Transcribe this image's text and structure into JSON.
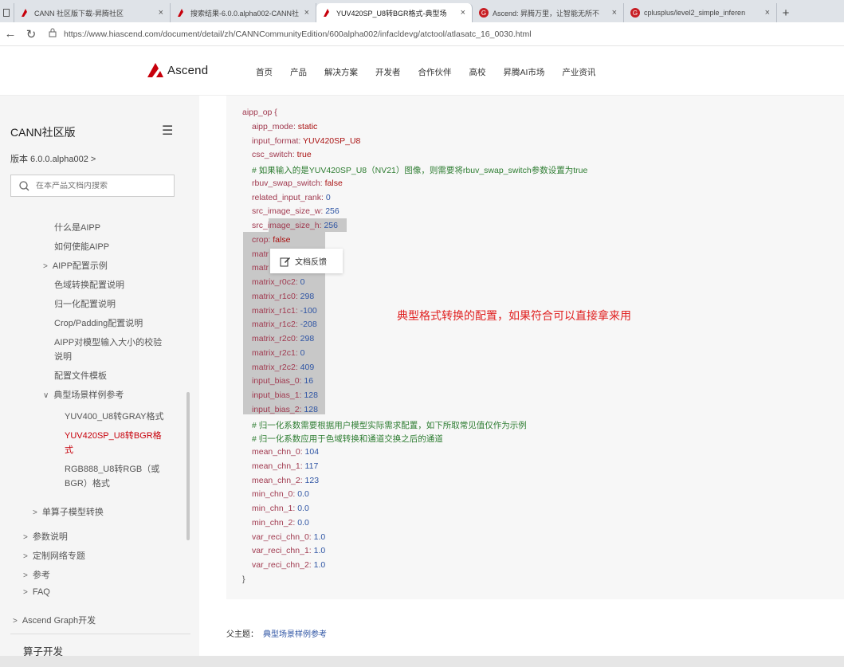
{
  "browser": {
    "tabs": [
      {
        "title": "CANN 社区版下载-昇腾社区",
        "icon": "ascend-logo",
        "active": false
      },
      {
        "title": "搜索结果-6.0.0.alpha002-CANN社",
        "icon": "ascend-logo",
        "active": false
      },
      {
        "title": "YUV420SP_U8转BGR格式-典型场",
        "icon": "ascend-logo",
        "active": true
      },
      {
        "title": "Ascend: 昇腾万里，让智能无所不",
        "icon": "gitee-logo",
        "active": false
      },
      {
        "title": "cplusplus/level2_simple_inferen",
        "icon": "gitee-logo",
        "active": false
      }
    ],
    "url": "https://www.hiascend.com/document/detail/zh/CANNCommunityEdition/600alpha002/infacldevg/atctool/atlasatc_16_0030.html"
  },
  "header": {
    "logo": "Ascend",
    "nav": [
      "首页",
      "产品",
      "解决方案",
      "开发者",
      "合作伙伴",
      "高校",
      "昇腾AI市场",
      "产业资讯"
    ]
  },
  "sidebar": {
    "title": "CANN社区版",
    "version": "版本  6.0.0.alpha002  >",
    "search_placeholder": "在本产品文档内搜索",
    "items": [
      {
        "label": "什么是AIPP",
        "arrow": ""
      },
      {
        "label": "如何使能AIPP",
        "arrow": ""
      },
      {
        "label": "AIPP配置示例",
        "arrow": ">"
      },
      {
        "label": "色域转换配置说明",
        "arrow": ""
      },
      {
        "label": "归一化配置说明",
        "arrow": ""
      },
      {
        "label": "Crop/Padding配置说明",
        "arrow": ""
      },
      {
        "label": "AIPP对模型输入大小的校验",
        "arrow": ""
      },
      {
        "label": "说明",
        "arrow": ""
      },
      {
        "label": "配置文件模板",
        "arrow": ""
      },
      {
        "label": "典型场景样例参考",
        "arrow": "∨"
      },
      {
        "label": "YUV400_U8转GRAY格式",
        "arrow": ""
      },
      {
        "label": "YUV420SP_U8转BGR格",
        "arrow": ""
      },
      {
        "label": "式",
        "arrow": ""
      },
      {
        "label": "RGB888_U8转RGB（或",
        "arrow": ""
      },
      {
        "label": "BGR）格式",
        "arrow": ""
      },
      {
        "label": "单算子模型转换",
        "arrow": ">"
      },
      {
        "label": "参数说明",
        "arrow": ">"
      },
      {
        "label": "定制网络专题",
        "arrow": ">"
      },
      {
        "label": "参考",
        "arrow": ">"
      },
      {
        "label": "FAQ",
        "arrow": ">"
      },
      {
        "label": "Ascend Graph开发",
        "arrow": ">"
      },
      {
        "label": "算子开发",
        "arrow": ""
      }
    ]
  },
  "code": {
    "lines": [
      {
        "k": "aipp_op {",
        "v": "",
        "type": "open"
      },
      {
        "k": "aipp_mode:",
        "v": " static",
        "type": "str"
      },
      {
        "k": "input_format:",
        "v": " YUV420SP_U8",
        "type": "str"
      },
      {
        "k": "csc_switch:",
        "v": " true",
        "type": "str"
      },
      {
        "k": "# 如果输入的是YUV420SP_U8（NV21）图像，则需要将rbuv_swap_switch参数设置为true",
        "v": "",
        "type": "cmt"
      },
      {
        "k": "rbuv_swap_switch:",
        "v": " false",
        "type": "str"
      },
      {
        "k": "related_input_rank:",
        "v": " 0",
        "type": "num"
      },
      {
        "k": "src_image_size_w:",
        "v": " 256",
        "type": "num"
      },
      {
        "k": "src_image_size_h:",
        "v": " 256",
        "type": "num"
      },
      {
        "k": "crop:",
        "v": " false",
        "type": "str"
      },
      {
        "k": "matr",
        "v": "",
        "type": "num"
      },
      {
        "k": "matr",
        "v": "",
        "type": "num"
      },
      {
        "k": "matrix_r0c2:",
        "v": " 0",
        "type": "num"
      },
      {
        "k": "matrix_r1c0:",
        "v": " 298",
        "type": "num"
      },
      {
        "k": "matrix_r1c1:",
        "v": " -100",
        "type": "num"
      },
      {
        "k": "matrix_r1c2:",
        "v": " -208",
        "type": "num"
      },
      {
        "k": "matrix_r2c0:",
        "v": " 298",
        "type": "num"
      },
      {
        "k": "matrix_r2c1:",
        "v": " 0",
        "type": "num"
      },
      {
        "k": "matrix_r2c2:",
        "v": " 409",
        "type": "num"
      },
      {
        "k": "input_bias_0:",
        "v": " 16",
        "type": "num"
      },
      {
        "k": "input_bias_1:",
        "v": " 128",
        "type": "num"
      },
      {
        "k": "input_bias_2:",
        "v": " 128",
        "type": "num"
      },
      {
        "k": "# 归一化系数需要根据用户模型实际需求配置，如下所取常见值仅作为示例",
        "v": "",
        "type": "cmt"
      },
      {
        "k": "# 归一化系数应用于色域转换和通道交换之后的通道",
        "v": "",
        "type": "cmt"
      },
      {
        "k": "mean_chn_0:",
        "v": " 104",
        "type": "num"
      },
      {
        "k": "mean_chn_1:",
        "v": " 117",
        "type": "num"
      },
      {
        "k": "mean_chn_2:",
        "v": " 123",
        "type": "num"
      },
      {
        "k": "min_chn_0:",
        "v": " 0.0",
        "type": "num"
      },
      {
        "k": "min_chn_1:",
        "v": " 0.0",
        "type": "num"
      },
      {
        "k": "min_chn_2:",
        "v": " 0.0",
        "type": "num"
      },
      {
        "k": "var_reci_chn_0:",
        "v": " 1.0",
        "type": "num"
      },
      {
        "k": "var_reci_chn_1:",
        "v": " 1.0",
        "type": "num"
      },
      {
        "k": "var_reci_chn_2:",
        "v": " 1.0",
        "type": "num"
      },
      {
        "k": "}",
        "v": "",
        "type": "close"
      }
    ]
  },
  "feedback_label": "文档反馈",
  "annotation": "典型格式转换的配置，如果符合可以直接拿来用",
  "parent_topic": {
    "label": "父主题：",
    "link": "典型场景样例参考"
  },
  "colors": {
    "accent": "#c7000b",
    "link": "#2f55a4",
    "comment": "#2e7d32",
    "annotation": "#e02020"
  }
}
